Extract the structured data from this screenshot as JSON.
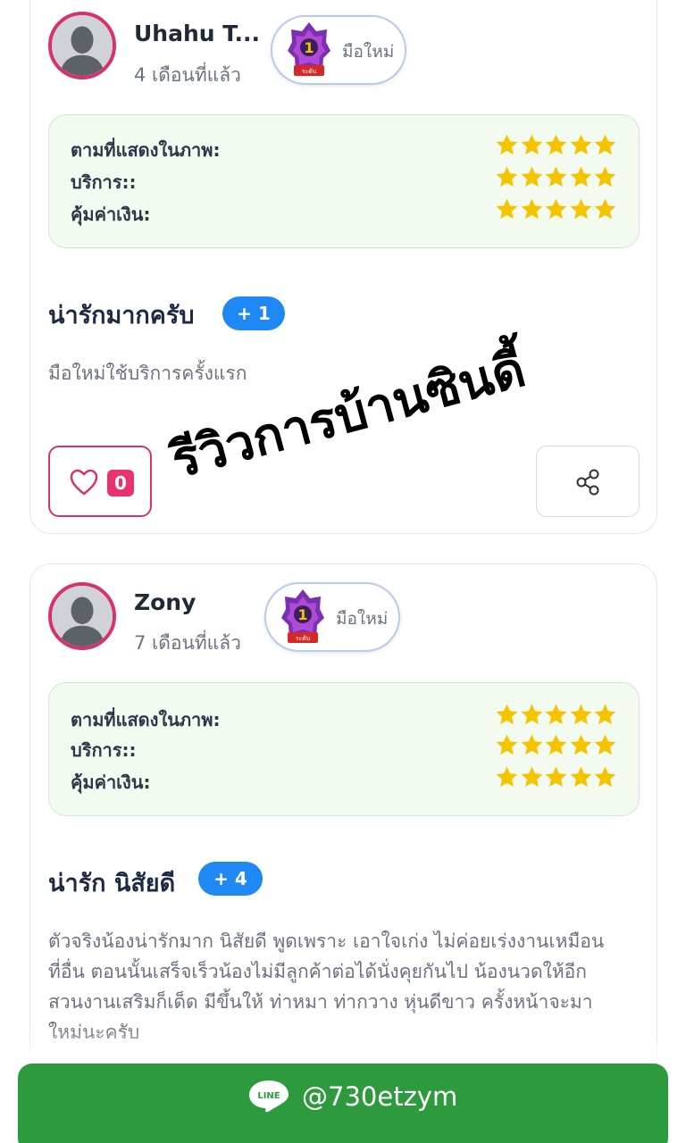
{
  "reviews": [
    {
      "username": "Uhahu T...",
      "time_ago": "4 เดือนที่แล้ว",
      "level_label": "มือใหม่",
      "medal_number": "1",
      "medal_ribbon": "ระดับ",
      "ratings": [
        {
          "label": "ตามที่แสดงในภาพ:",
          "stars": 5
        },
        {
          "label": "บริการ::",
          "stars": 5
        },
        {
          "label": "คุ้มค่าเงิน:",
          "stars": 5
        }
      ],
      "title": "น่ารักมากครับ",
      "plus_count": "+ 1",
      "text": "มือใหม่ใช้บริการครั้งแรก",
      "like_count": "0"
    },
    {
      "username": "Zony",
      "time_ago": "7 เดือนที่แล้ว",
      "level_label": "มือใหม่",
      "medal_number": "1",
      "medal_ribbon": "ระดับ",
      "ratings": [
        {
          "label": "ตามที่แสดงในภาพ:",
          "stars": 5
        },
        {
          "label": "บริการ::",
          "stars": 5
        },
        {
          "label": "คุ้มค่าเงิน:",
          "stars": 5
        }
      ],
      "title": "น่ารัก นิสัยดี",
      "plus_count": "+ 4",
      "text_lines": [
        "ตัวจริงน้องน่ารักมาก นิสัยดี พูดเพราะ เอาใจเก่ง ไม่ค่อยเร่งงานเหมือน",
        "ที่อื่น ตอนนั้นเสร็จเร็วน้องไม่มีลูกค้าต่อได้นั่งคุยกันไป น้องนวดให้อีก",
        "สวนงานเสริมก็เด็ด มีขึ้นให้ ท่าหมา ท่ากวาง หุ่นดีขาว ครั้งหน้าจะมา",
        "ใหม่นะครับ"
      ]
    }
  ],
  "watermark": "รีวิวการบ้านซินดี้",
  "line_button": {
    "logo_text": "LINE",
    "id": "@730etzym"
  },
  "colors": {
    "star": "#f5c400",
    "accent_pink": "#d6336c",
    "line_green": "#2d9a3e",
    "badge_blue": "#1e88f5"
  }
}
